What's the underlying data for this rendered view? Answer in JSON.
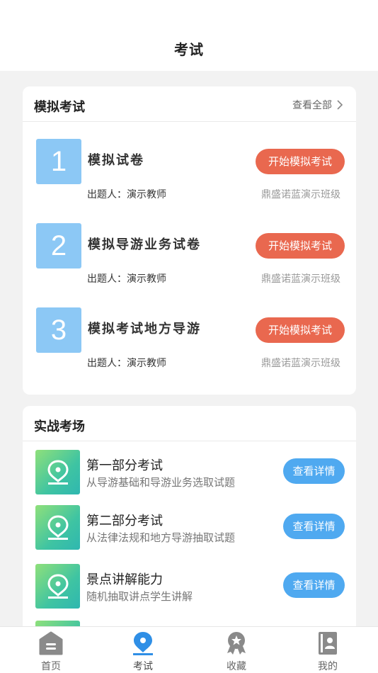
{
  "header": {
    "title": "考试"
  },
  "mock_section": {
    "title": "模拟考试",
    "see_all": "查看全部",
    "items": [
      {
        "number": "1",
        "title": "模拟试卷",
        "button": "开始模拟考试",
        "author": "出题人：演示教师",
        "class": "鼎盛诺蓝演示班级"
      },
      {
        "number": "2",
        "title": "模拟导游业务试卷",
        "button": "开始模拟考试",
        "author": "出题人：演示教师",
        "class": "鼎盛诺蓝演示班级"
      },
      {
        "number": "3",
        "title": "模拟考试地方导游",
        "button": "开始模拟考试",
        "author": "出题人：演示教师",
        "class": "鼎盛诺蓝演示班级"
      }
    ]
  },
  "practice_section": {
    "title": "实战考场",
    "items": [
      {
        "title": "第一部分考试",
        "subtitle": "从导游基础和导游业务选取试题",
        "button": "查看详情"
      },
      {
        "title": "第二部分考试",
        "subtitle": "从法律法规和地方导游抽取试题",
        "button": "查看详情"
      },
      {
        "title": "景点讲解能力",
        "subtitle": "随机抽取讲点学生讲解",
        "button": "查看详情"
      }
    ]
  },
  "tabbar": {
    "items": [
      {
        "label": "首页",
        "icon": "home-icon"
      },
      {
        "label": "考试",
        "icon": "exam-pen-icon",
        "active": true
      },
      {
        "label": "收藏",
        "icon": "favorite-badge-icon"
      },
      {
        "label": "我的",
        "icon": "profile-icon"
      }
    ]
  },
  "colors": {
    "start_button": "#e9684f",
    "detail_button": "#4fa9f0",
    "number_box": "#8cc8f5",
    "active_tab": "#2f8fe6"
  }
}
